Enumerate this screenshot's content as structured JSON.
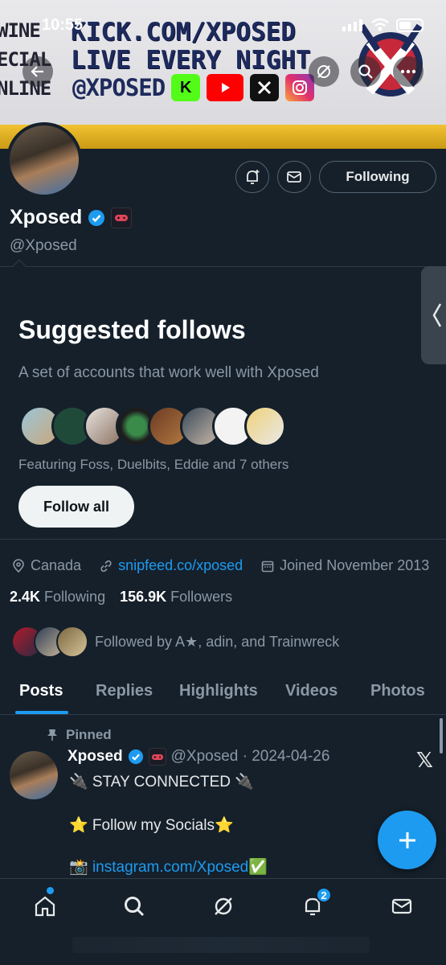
{
  "status_bar": {
    "time": "10:55"
  },
  "banner": {
    "left_text": [
      "WINE",
      "ECIAL",
      "NLINE"
    ],
    "line1": "KICK.COM/XPOSED",
    "line2": "LIVE EVERY NIGHT",
    "handle": "@XPOSED",
    "socials": [
      "kick-icon",
      "youtube-icon",
      "x-icon",
      "instagram-icon"
    ],
    "kick_letter": "K"
  },
  "profile": {
    "name": "Xposed",
    "handle": "@Xposed",
    "following_button": "Following",
    "location": "Canada",
    "website": "snipfeed.co/xposed",
    "joined": "Joined November 2013",
    "following_count": "2.4K",
    "following_label": "Following",
    "followers_count": "156.9K",
    "followers_label": "Followers",
    "followed_by": "Followed by A★, adin, and Trainwreck"
  },
  "suggested": {
    "title": "Suggested follows",
    "subtitle": "A set of accounts that work well with Xposed",
    "featuring": "Featuring Foss, Duelbits, Eddie and 7 others",
    "follow_all": "Follow all"
  },
  "tabs": [
    "Posts",
    "Replies",
    "Highlights",
    "Videos",
    "Photos"
  ],
  "post": {
    "pinned_label": "Pinned",
    "author": "Xposed",
    "handle_date": "@Xposed · 2024-04-26",
    "line1": "🔌 STAY CONNECTED 🔌",
    "line2": "⭐ Follow my Socials⭐",
    "line3_prefix": "📸 ",
    "line3_link": "instagram.com/Xposed",
    "line3_suffix": "✅"
  },
  "nav": {
    "notifications_badge": "2"
  },
  "colors": {
    "accent": "#1d9bf0",
    "bg": "#15202b",
    "text": "#e7e9ea",
    "muted": "#8b98a5"
  }
}
